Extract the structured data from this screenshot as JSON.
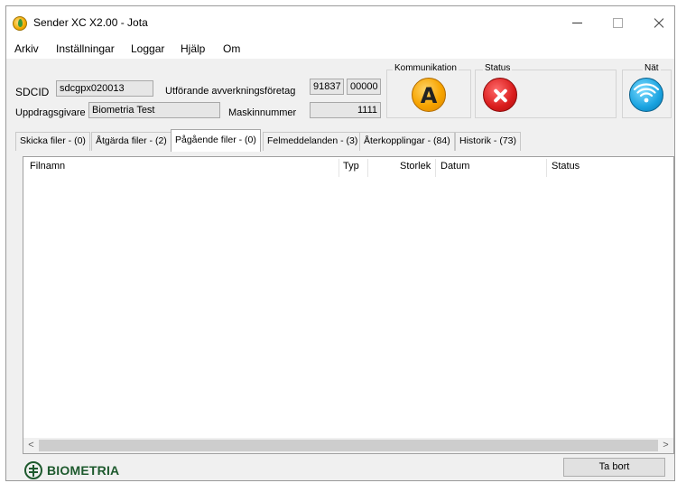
{
  "window": {
    "title": "Sender XC X2.00 - Jota"
  },
  "menu": {
    "items": [
      "Arkiv",
      "Inställningar",
      "Loggar",
      "Hjälp",
      "Om"
    ]
  },
  "header": {
    "sdcid_label": "SDCID",
    "sdcid_value": "sdcgpx020013",
    "uppdragsgivare_label": "Uppdragsgivare",
    "uppdragsgivare_value": "Biometria Test",
    "utforande_label": "Utförande avverkningsföretag",
    "utforande_value_1": "91837",
    "utforande_value_2": "00000",
    "maskinnummer_label": "Maskinnummer",
    "maskinnummer_value": "1111"
  },
  "status_panel": {
    "kommunikation_label": "Kommunikation",
    "kommunikation_icon": "a-letter-icon",
    "kommunikation_letter": "A",
    "status_label": "Status",
    "status_icon": "error-x-icon",
    "nat_label": "Nät",
    "nat_icon": "wifi-icon"
  },
  "tabs": [
    {
      "label": "Skicka filer - (0)",
      "active": false
    },
    {
      "label": "Åtgärda filer - (2)",
      "active": false
    },
    {
      "label": "Pågående filer - (0)",
      "active": true
    },
    {
      "label": "Felmeddelanden - (3)",
      "active": false
    },
    {
      "label": "Återkopplingar - (84)",
      "active": false
    },
    {
      "label": "Historik - (73)",
      "active": false
    }
  ],
  "file_list": {
    "columns": [
      "Filnamn",
      "Typ",
      "Storlek",
      "Datum",
      "Status"
    ],
    "rows": []
  },
  "footer": {
    "logo_text": "BIOMETRIA",
    "delete_button": "Ta bort"
  },
  "colors": {
    "logo_green": "#1e5a2e",
    "window_bg": "#f0f0f0"
  }
}
